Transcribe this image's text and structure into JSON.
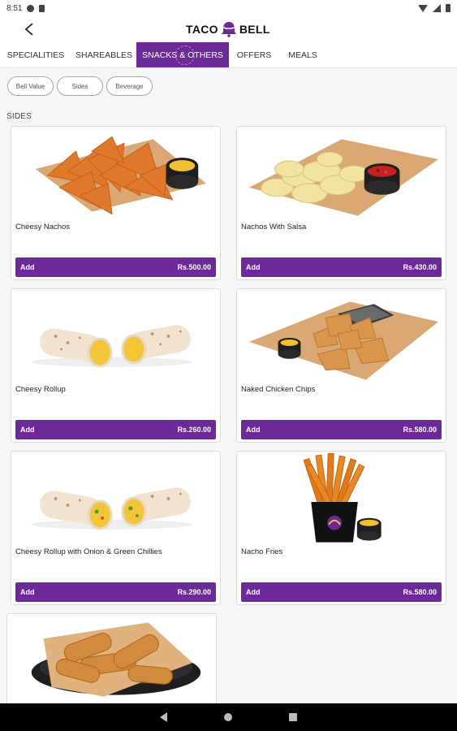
{
  "status_bar": {
    "time": "8:51"
  },
  "app_bar": {
    "logo_left": "TACO",
    "logo_right": "BELL"
  },
  "tabs": [
    {
      "label": "SPECIALITIES"
    },
    {
      "label": "SHAREABLES"
    },
    {
      "label": "SNACKS & OTHERS",
      "active": true
    },
    {
      "label": "OFFERS"
    },
    {
      "label": "MEALS"
    }
  ],
  "filters": [
    {
      "label": "Bell Value"
    },
    {
      "label": "Sides"
    },
    {
      "label": "Beverage"
    }
  ],
  "section": {
    "title": "SIDES"
  },
  "products": [
    {
      "name": "Cheesy Nachos",
      "add_label": "Add",
      "price": "Rs.500.00",
      "image": "nachos-with-cheese-dip"
    },
    {
      "name": "Nachos With Salsa",
      "add_label": "Add",
      "price": "Rs.430.00",
      "image": "chips-with-salsa-dip"
    },
    {
      "name": "Cheesy Rollup",
      "add_label": "Add",
      "price": "Rs.260.00",
      "image": "cheesy-rollup"
    },
    {
      "name": "Naked Chicken Chips",
      "add_label": "Add",
      "price": "Rs.580.00",
      "image": "chicken-chips-with-dip"
    },
    {
      "name": "Cheesy Rollup with Onion & Green Chillies",
      "add_label": "Add",
      "price": "Rs.290.00",
      "image": "rollup-onion-chillies"
    },
    {
      "name": "Nacho Fries",
      "add_label": "Add",
      "price": "Rs.580.00",
      "image": "nacho-fries-cup"
    }
  ],
  "partial_product": {
    "image": "chicken-strips-basket"
  },
  "colors": {
    "brand_purple": "#6b2a97",
    "background": "#f6f6f8"
  }
}
